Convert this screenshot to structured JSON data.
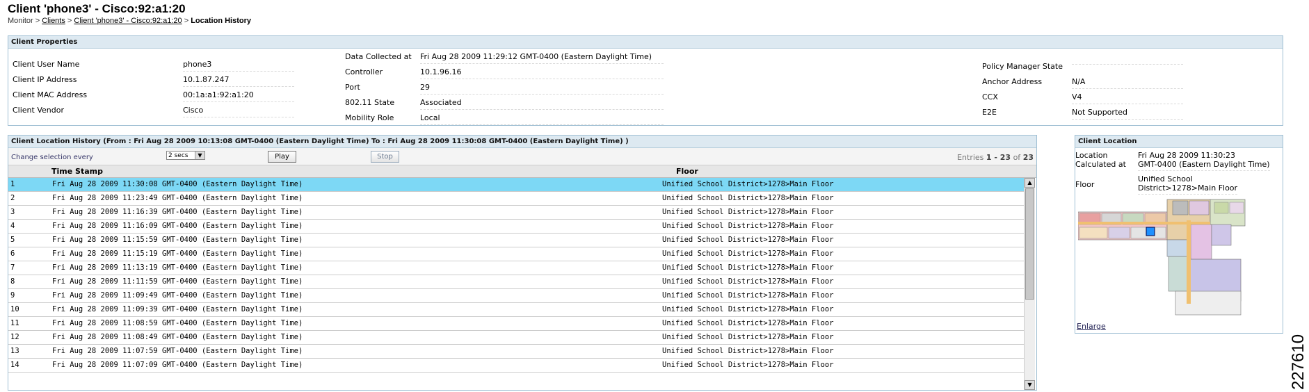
{
  "page": {
    "title": "Client 'phone3' - Cisco:92:a1:20",
    "breadcrumb": {
      "monitor": "Monitor",
      "sep1": " > ",
      "clients": "Clients",
      "sep2": " > ",
      "client": "Client 'phone3' - Cisco:92:a1:20",
      "sep3": " > ",
      "current": "Location History"
    }
  },
  "props": {
    "header": "Client Properties",
    "col1": [
      {
        "k": "Client User Name",
        "v": "phone3"
      },
      {
        "k": "Client IP Address",
        "v": "10.1.87.247"
      },
      {
        "k": "Client MAC Address",
        "v": "00:1a:a1:92:a1:20"
      },
      {
        "k": "Client Vendor",
        "v": "Cisco"
      }
    ],
    "col2": [
      {
        "k": "Data Collected at",
        "v": "Fri Aug 28 2009 11:29:12 GMT-0400 (Eastern Daylight Time)"
      },
      {
        "k": "Controller",
        "v": "10.1.96.16"
      },
      {
        "k": "Port",
        "v": "29"
      },
      {
        "k": "802.11 State",
        "v": "Associated"
      },
      {
        "k": "Mobility Role",
        "v": "Local"
      }
    ],
    "col3": [
      {
        "k": "Policy Manager State",
        "v": ""
      },
      {
        "k": "Anchor Address",
        "v": "N/A"
      },
      {
        "k": "CCX",
        "v": "V4"
      },
      {
        "k": "E2E",
        "v": "Not Supported"
      }
    ]
  },
  "history": {
    "header": "Client Location History (From : Fri Aug 28 2009 10:13:08 GMT-0400 (Eastern Daylight Time) To : Fri Aug 28 2009 11:30:08 GMT-0400 (Eastern Daylight Time) )",
    "change_label": "Change selection every",
    "interval": "2 secs",
    "play": "Play",
    "stop": "Stop",
    "entries_prefix": "Entries ",
    "entries_range": "1 - 23",
    "entries_of": " of ",
    "entries_total": "23",
    "col_timestamp": "Time Stamp",
    "col_floor": "Floor",
    "rows": [
      {
        "n": "1",
        "ts": "Fri Aug 28 2009 11:30:08 GMT-0400 (Eastern Daylight Time)",
        "floor": "Unified School District>1278>Main Floor"
      },
      {
        "n": "2",
        "ts": "Fri Aug 28 2009 11:23:49 GMT-0400 (Eastern Daylight Time)",
        "floor": "Unified School District>1278>Main Floor"
      },
      {
        "n": "3",
        "ts": "Fri Aug 28 2009 11:16:39 GMT-0400 (Eastern Daylight Time)",
        "floor": "Unified School District>1278>Main Floor"
      },
      {
        "n": "4",
        "ts": "Fri Aug 28 2009 11:16:09 GMT-0400 (Eastern Daylight Time)",
        "floor": "Unified School District>1278>Main Floor"
      },
      {
        "n": "5",
        "ts": "Fri Aug 28 2009 11:15:59 GMT-0400 (Eastern Daylight Time)",
        "floor": "Unified School District>1278>Main Floor"
      },
      {
        "n": "6",
        "ts": "Fri Aug 28 2009 11:15:19 GMT-0400 (Eastern Daylight Time)",
        "floor": "Unified School District>1278>Main Floor"
      },
      {
        "n": "7",
        "ts": "Fri Aug 28 2009 11:13:19 GMT-0400 (Eastern Daylight Time)",
        "floor": "Unified School District>1278>Main Floor"
      },
      {
        "n": "8",
        "ts": "Fri Aug 28 2009 11:11:59 GMT-0400 (Eastern Daylight Time)",
        "floor": "Unified School District>1278>Main Floor"
      },
      {
        "n": "9",
        "ts": "Fri Aug 28 2009 11:09:49 GMT-0400 (Eastern Daylight Time)",
        "floor": "Unified School District>1278>Main Floor"
      },
      {
        "n": "10",
        "ts": "Fri Aug 28 2009 11:09:39 GMT-0400 (Eastern Daylight Time)",
        "floor": "Unified School District>1278>Main Floor"
      },
      {
        "n": "11",
        "ts": "Fri Aug 28 2009 11:08:59 GMT-0400 (Eastern Daylight Time)",
        "floor": "Unified School District>1278>Main Floor"
      },
      {
        "n": "12",
        "ts": "Fri Aug 28 2009 11:08:49 GMT-0400 (Eastern Daylight Time)",
        "floor": "Unified School District>1278>Main Floor"
      },
      {
        "n": "13",
        "ts": "Fri Aug 28 2009 11:07:59 GMT-0400 (Eastern Daylight Time)",
        "floor": "Unified School District>1278>Main Floor"
      },
      {
        "n": "14",
        "ts": "Fri Aug 28 2009 11:07:09 GMT-0400 (Eastern Daylight Time)",
        "floor": "Unified School District>1278>Main Floor"
      }
    ]
  },
  "location": {
    "header": "Client Location",
    "calc_label_1": "Location",
    "calc_label_2": "Calculated at",
    "calc_value_1": "Fri Aug 28 2009 11:30:23",
    "calc_value_2": "GMT-0400 (Eastern Daylight Time)",
    "floor_label": "Floor",
    "floor_value_1": "Unified School",
    "floor_value_2": "District>1278>Main Floor",
    "enlarge": "Enlarge"
  },
  "figure_number": "227610",
  "colors": {
    "selected_row": "#7dd8f5",
    "panel_header": "#dde9f1",
    "client_marker": "#1e90ff"
  }
}
